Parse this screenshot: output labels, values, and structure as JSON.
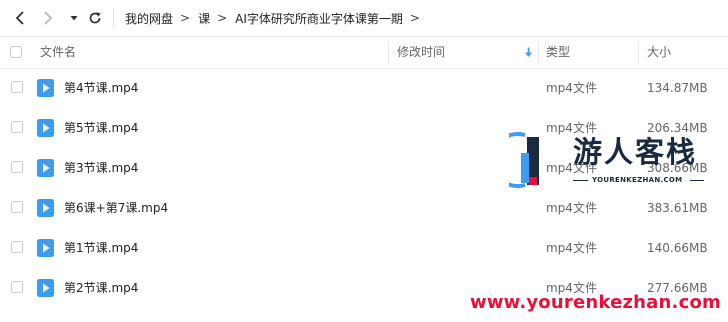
{
  "breadcrumb": {
    "items": [
      "我的网盘",
      "课",
      "AI字体研究所商业字体课第一期"
    ],
    "separator": ">"
  },
  "columns": {
    "name": "文件名",
    "modified": "修改时间",
    "type": "类型",
    "size": "大小"
  },
  "files": [
    {
      "name": "第4节课.mp4",
      "type": "mp4文件",
      "size": "134.87MB"
    },
    {
      "name": "第5节课.mp4",
      "type": "mp4文件",
      "size": "206.34MB"
    },
    {
      "name": "第3节课.mp4",
      "type": "mp4文件",
      "size": "308.66MB"
    },
    {
      "name": "第6课+第7课.mp4",
      "type": "mp4文件",
      "size": "383.61MB"
    },
    {
      "name": "第1节课.mp4",
      "type": "mp4文件",
      "size": "140.66MB"
    },
    {
      "name": "第2节课.mp4",
      "type": "mp4文件",
      "size": "277.66MB"
    }
  ],
  "watermark": {
    "title": "游人客栈",
    "subtitle": "YOURENKEZHAN.COM",
    "url": "www.yourenkezhan.com"
  },
  "colors": {
    "accent": "#3d9cf0",
    "watermark_red": "#e8103a",
    "watermark_dark": "#1b2a40"
  },
  "icons": {
    "back": "chevron-left-icon",
    "forward": "chevron-right-icon",
    "history": "caret-down-icon",
    "refresh": "refresh-icon",
    "sort": "sort-down-arrow-icon",
    "file": "video-play-file-icon"
  }
}
